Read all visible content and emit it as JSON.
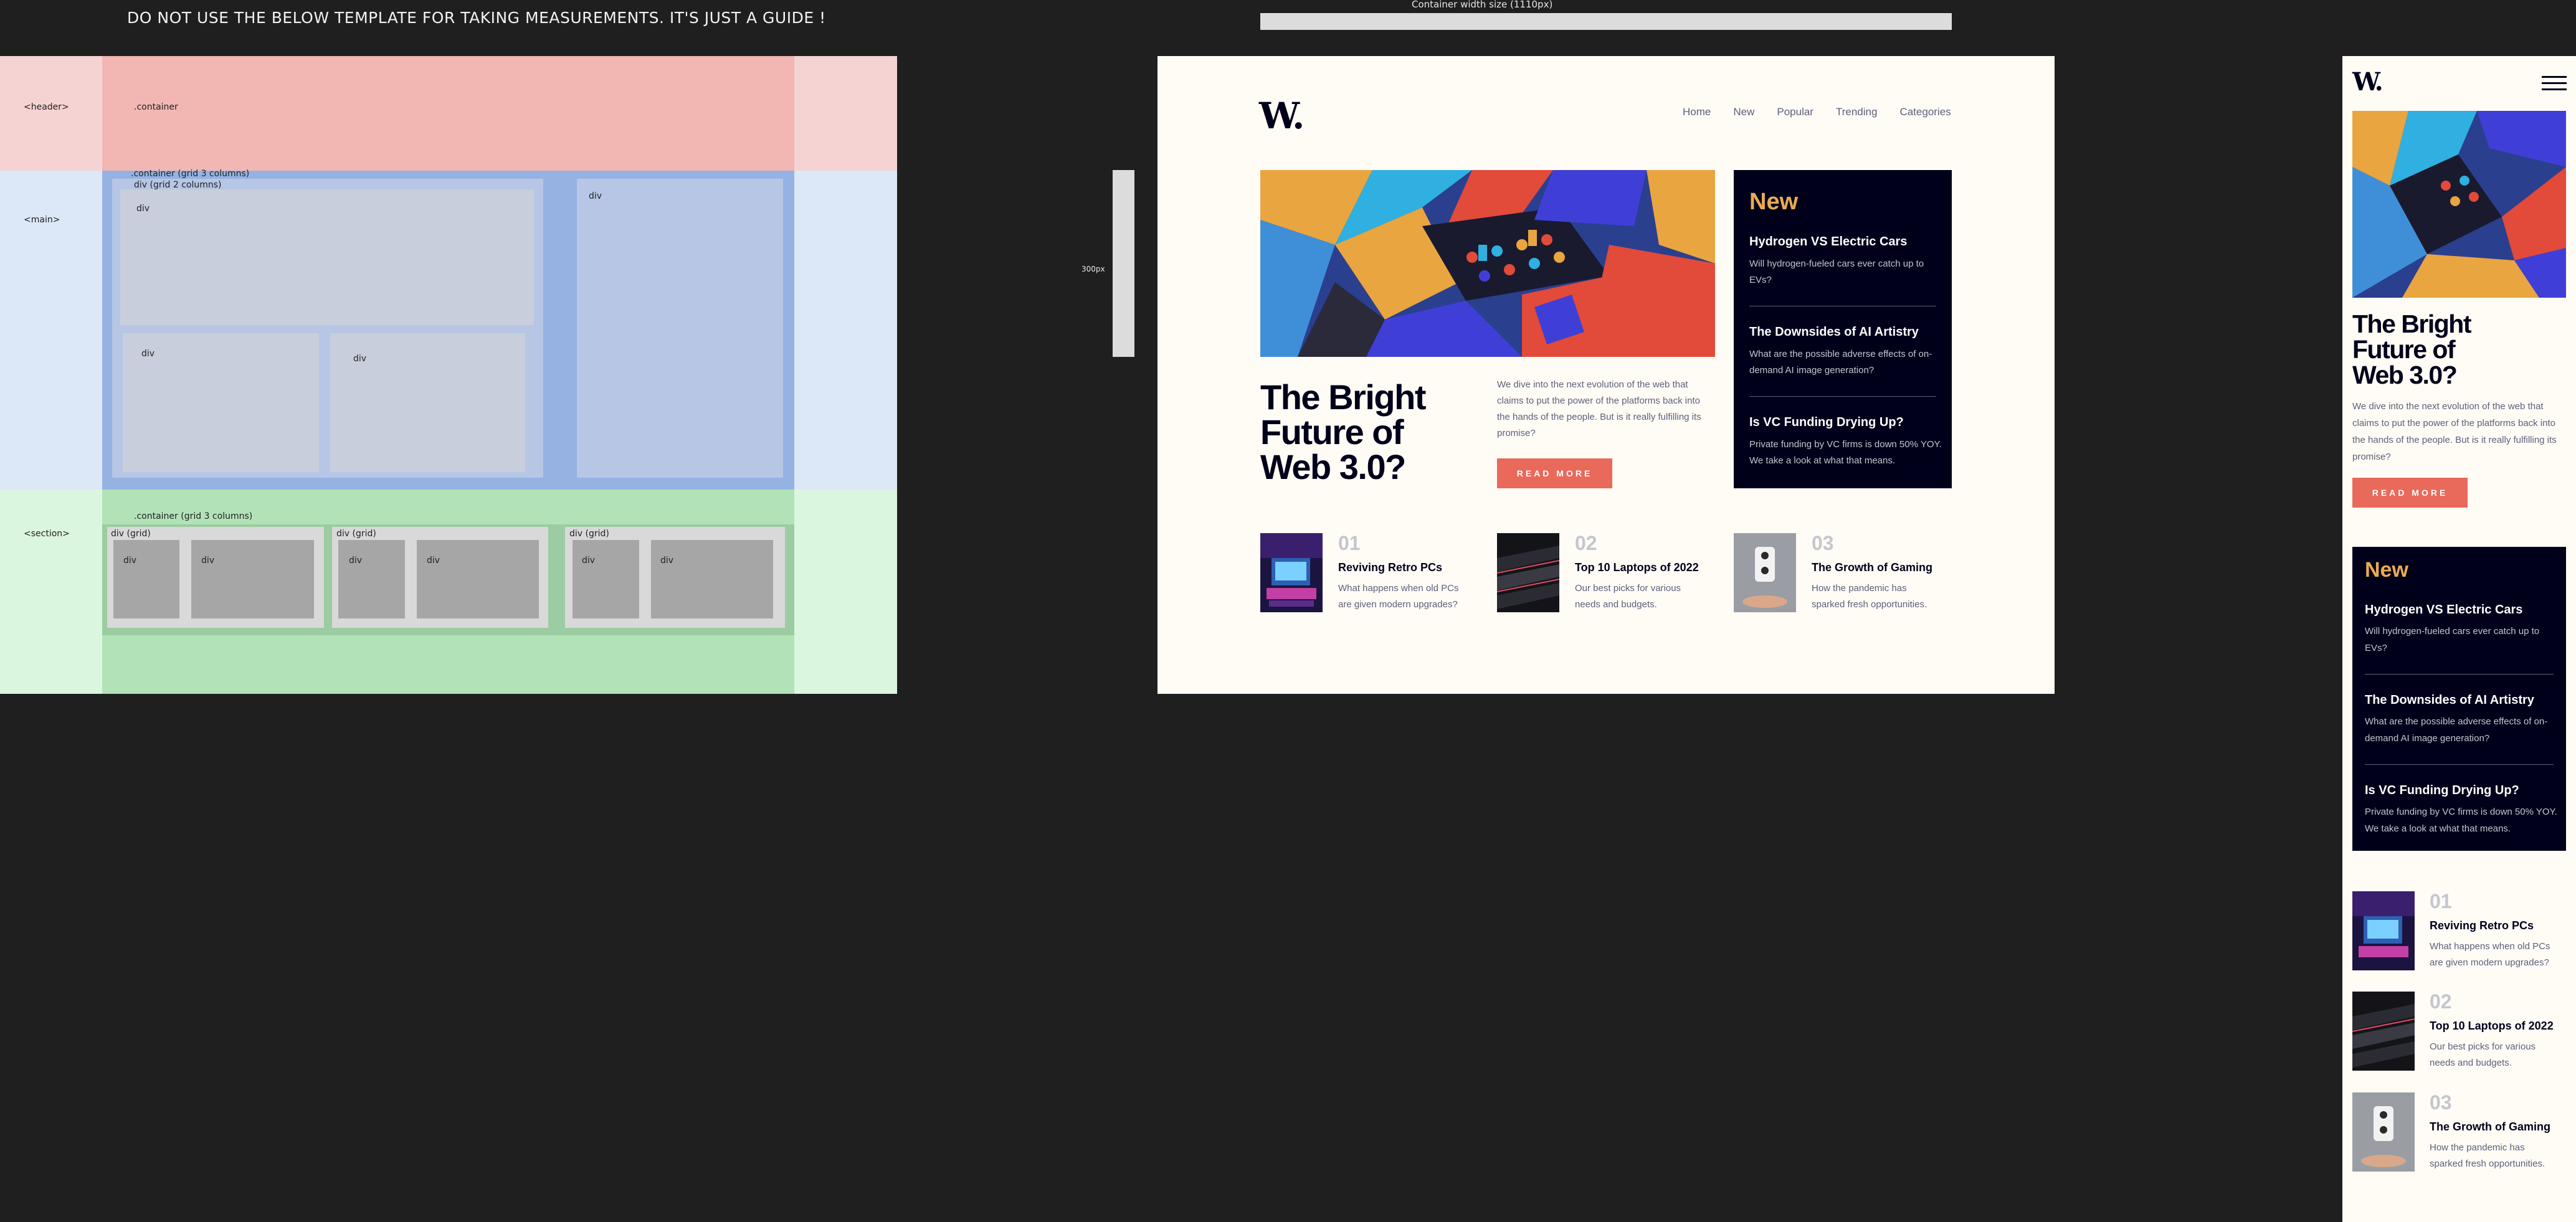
{
  "guide": {
    "note": "DO NOT USE THE BELOW TEMPLATE FOR TAKING MEASUREMENTS. IT'S JUST A GUIDE !",
    "header_label": "<header>",
    "header_container": ".container",
    "main_label": "<main>",
    "main_container": ".container (grid 3 columns)",
    "main_sub": "div (grid 2 columns)",
    "div": "div",
    "section_label": "<section>",
    "section_container": ".container (grid 3 columns)",
    "div_grid": "div (grid)"
  },
  "measure": {
    "container_caption": "Container width size (1110px)",
    "height_caption": "300px"
  },
  "site": {
    "logo": "W.",
    "nav": [
      "Home",
      "New",
      "Popular",
      "Trending",
      "Categories"
    ],
    "hero": {
      "title_line1": "The Bright",
      "title_line2": "Future of",
      "title_line3": "Web 3.0?",
      "description": "We dive into the next evolution of the web that claims to put the power of the platforms back into the hands of the people. But is it really fulfilling its promise?",
      "button": "READ MORE"
    },
    "new": {
      "heading": "New",
      "items": [
        {
          "title": "Hydrogen VS Electric Cars",
          "desc": "Will hydrogen-fueled cars ever catch up to EVs?"
        },
        {
          "title": "The Downsides of AI Artistry",
          "desc": "What are the possible adverse effects of on-demand AI image generation?"
        },
        {
          "title": "Is VC Funding Drying Up?",
          "desc": "Private funding by VC firms is down 50% YOY. We take a look at what that means."
        }
      ]
    },
    "cards": [
      {
        "num": "01",
        "title": "Reviving Retro PCs",
        "desc": "What happens when old PCs are given modern upgrades?"
      },
      {
        "num": "02",
        "title": "Top 10 Laptops of 2022",
        "desc": "Our best picks for various needs and budgets."
      },
      {
        "num": "03",
        "title": "The Growth of Gaming",
        "desc": "How the pandemic has sparked fresh opportunities."
      }
    ],
    "menu_icon": "hamburger-menu-icon",
    "colors": {
      "accent": "#e9695b",
      "new_heading": "#e9ab53",
      "dark": "#00001a",
      "muted": "#5d5f79",
      "page_bg": "#fffcf6"
    }
  }
}
